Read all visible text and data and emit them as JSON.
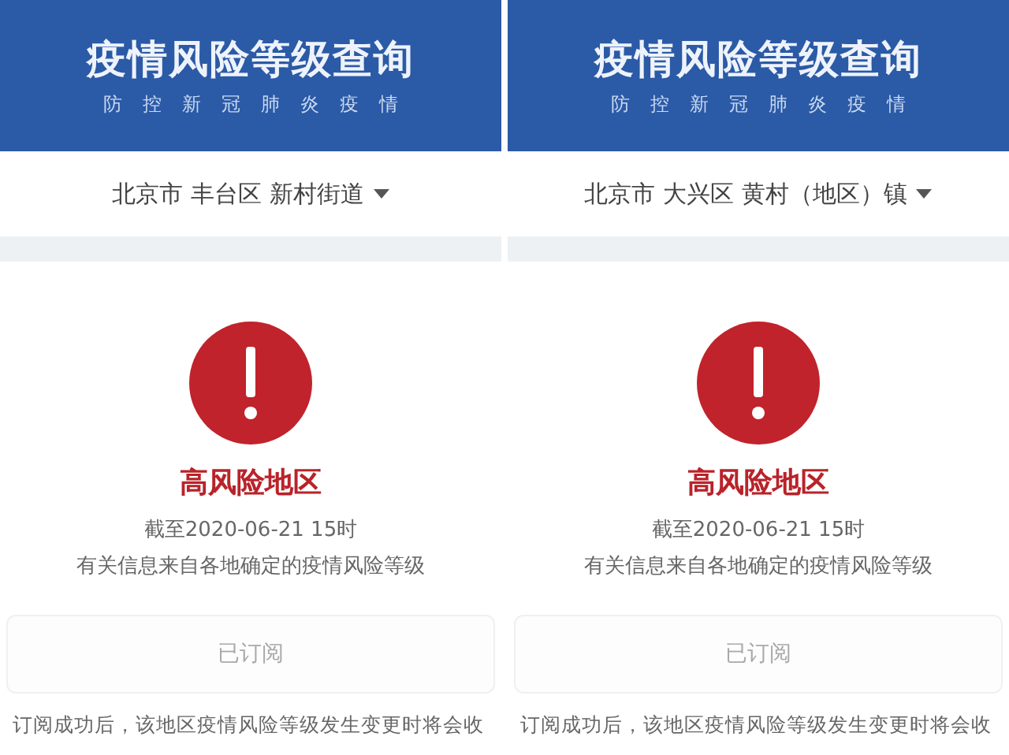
{
  "panels": [
    {
      "header": {
        "title": "疫情风险等级查询",
        "subtitle": "防控新冠肺炎疫情"
      },
      "location": "北京市 丰台区 新村街道",
      "risk_level": "高风险地区",
      "as_of": "截至2020-06-21 15时",
      "info": "有关信息来自各地确定的疫情风险等级",
      "subscribe_button": {
        "label": "已订阅",
        "disabled": true
      },
      "note": "订阅成功后，该地区疫情风险等级发生变更时将会收"
    },
    {
      "header": {
        "title": "疫情风险等级查询",
        "subtitle": "防控新冠肺炎疫情"
      },
      "location": "北京市 大兴区 黄村（地区）镇",
      "risk_level": "高风险地区",
      "as_of": "截至2020-06-21 15时",
      "info": "有关信息来自各地确定的疫情风险等级",
      "subscribe_button": {
        "label": "已订阅",
        "disabled": true
      },
      "note": "订阅成功后，该地区疫情风险等级发生变更时将会收"
    }
  ]
}
